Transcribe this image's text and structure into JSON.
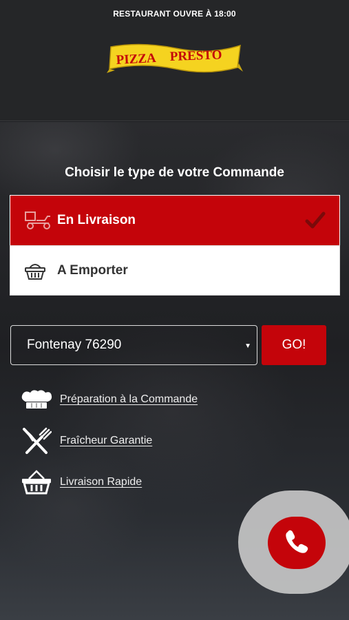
{
  "header": {
    "status_text": "RESTAURANT OUVRE À 18:00",
    "logo_text": {
      "word1": "PIZZA",
      "word2": "PRESTO"
    }
  },
  "order_type": {
    "title": "Choisir le type de votre Commande",
    "options": [
      {
        "label": "En Livraison",
        "icon": "delivery-scooter-icon",
        "selected": true
      },
      {
        "label": "A Emporter",
        "icon": "basket-icon",
        "selected": false
      }
    ]
  },
  "location": {
    "selected_value": "Fontenay 76290",
    "go_label": "GO!"
  },
  "features": [
    {
      "label": "Préparation à la Commande",
      "icon": "chef-hat-icon"
    },
    {
      "label": "Fraîcheur Garantie",
      "icon": "fork-knife-icon"
    },
    {
      "label": "Livraison Rapide",
      "icon": "basket-icon"
    }
  ],
  "colors": {
    "accent": "#c4040a",
    "header_bg": "#252628",
    "logo_banner": "#f5d320",
    "logo_text": "#c4040a"
  },
  "call_button": {
    "icon": "phone-icon"
  }
}
